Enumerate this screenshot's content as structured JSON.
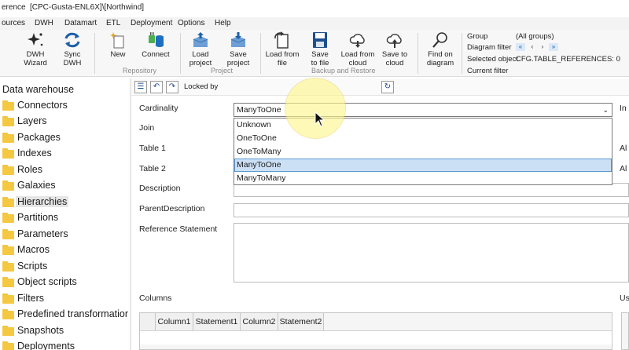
{
  "titlebar": {
    "app_fragment": "erence",
    "connection": "[CPC-Gusta-ENL6X]\\[Northwind]"
  },
  "menu": [
    "ources",
    "DWH",
    "Datamart",
    "ETL",
    "Deployment",
    "Options",
    "Help"
  ],
  "ribbon": {
    "buttons": [
      {
        "icon": "dwh-wizard-icon",
        "label1": "DWH",
        "label2": "Wizard"
      },
      {
        "icon": "sync-icon",
        "label1": "Sync",
        "label2": "DWH"
      },
      {
        "icon": "new-icon",
        "label1": "New",
        "label2": ""
      },
      {
        "icon": "connect-icon",
        "label1": "Connect",
        "label2": ""
      },
      {
        "icon": "load-project-icon",
        "label1": "Load",
        "label2": "project"
      },
      {
        "icon": "save-project-icon",
        "label1": "Save",
        "label2": "project"
      },
      {
        "icon": "load-file-icon",
        "label1": "Load from",
        "label2": "file"
      },
      {
        "icon": "save-file-icon",
        "label1": "Save",
        "label2": "to file"
      },
      {
        "icon": "load-cloud-icon",
        "label1": "Load from",
        "label2": "cloud"
      },
      {
        "icon": "save-cloud-icon",
        "label1": "Save to",
        "label2": "cloud"
      },
      {
        "icon": "find-icon",
        "label1": "Find on",
        "label2": "diagram"
      }
    ],
    "groups": [
      "Repository",
      "Project",
      "Backup and Restore"
    ],
    "info": {
      "group_label": "Group",
      "group_value": "(All groups)",
      "filter_label": "Diagram filter",
      "selected_label": "Selected object",
      "selected_value": "CFG.TABLE_REFERENCES: 0",
      "current_filter_label": "Current filter"
    }
  },
  "tree": {
    "header": "Data warehouse",
    "items": [
      "Connectors",
      "Layers",
      "Packages",
      "Indexes",
      "Roles",
      "Galaxies",
      "Hierarchies",
      "Partitions",
      "Parameters",
      "Macros",
      "Scripts",
      "Object scripts",
      "Filters",
      "Predefined transformation",
      "Snapshots",
      "Deployments"
    ],
    "selected": "Hierarchies"
  },
  "toolbar": {
    "locked_label": "Locked by"
  },
  "form": {
    "labels": {
      "cardinality": "Cardinality",
      "join": "Join",
      "table1": "Table 1",
      "table2": "Table 2",
      "description": "Description",
      "parent_description": "ParentDescription",
      "reference_statement": "Reference Statement",
      "columns": "Columns"
    },
    "cardinality_value": "ManyToOne",
    "cardinality_options": [
      "Unknown",
      "OneToOne",
      "OneToMany",
      "ManyToOne",
      "ManyToMany"
    ],
    "highlighted_option": "ManyToOne",
    "right_labels": {
      "top": "In",
      "table1": "Al",
      "table2": "Al",
      "columns": "Us"
    }
  },
  "grid": {
    "headers": [
      "Column1",
      "Statement1",
      "Column2",
      "Statement2"
    ]
  }
}
